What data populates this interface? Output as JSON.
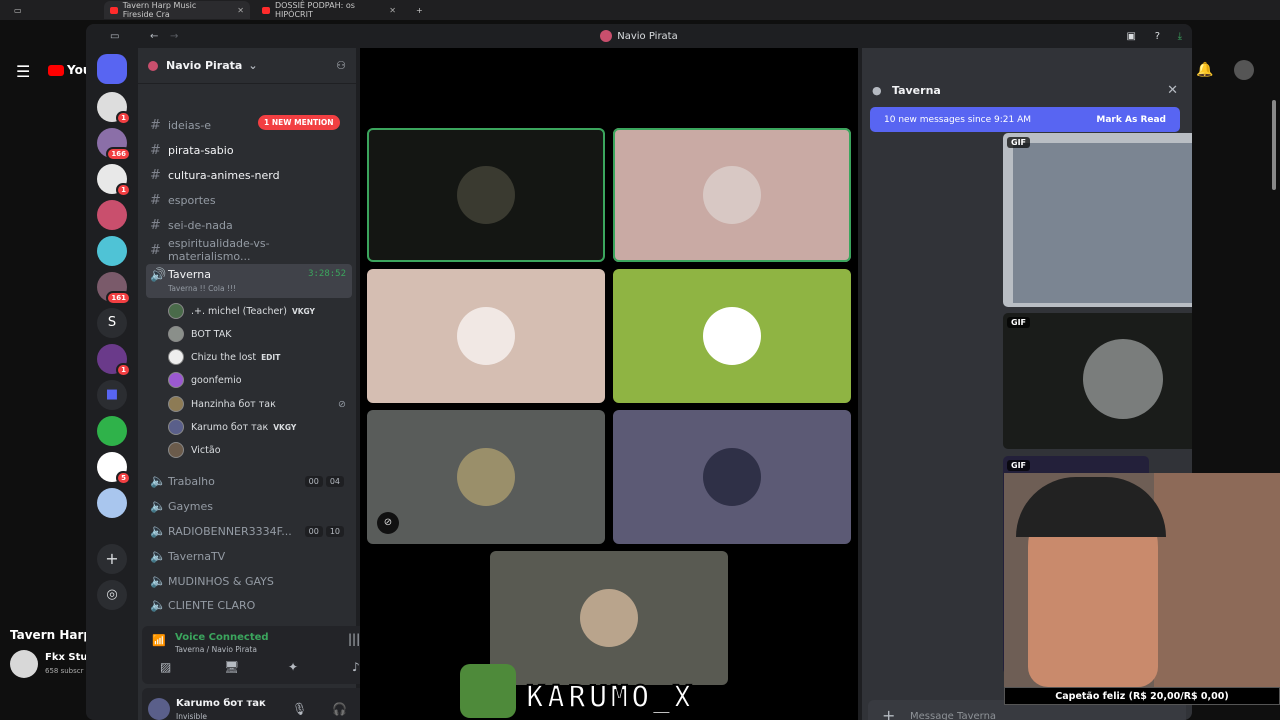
{
  "browser": {
    "tabs": [
      {
        "title": "Tavern Harp Music Fireside Cra"
      },
      {
        "title": "DOSSIÊ PODPAH: os HIPÓCRIT"
      }
    ]
  },
  "youtube": {
    "logo": "You",
    "video_title": "Tavern Harp",
    "channel_name": "Fkx Stud",
    "subscribers": "658 subscr"
  },
  "discord": {
    "window_title": "Navio Pirata",
    "server_name": "Navio Pirata",
    "mention_pill": "1 NEW MENTION",
    "channels": [
      {
        "name": "ideias-e",
        "type": "text"
      },
      {
        "name": "pirata-sabio",
        "type": "text",
        "bright": true
      },
      {
        "name": "cultura-animes-nerd",
        "type": "text",
        "bright": true
      },
      {
        "name": "esportes",
        "type": "text"
      },
      {
        "name": "sei-de-nada",
        "type": "text"
      },
      {
        "name": "espiritualidade-vs-materialismo...",
        "type": "text"
      }
    ],
    "voice_channel": {
      "name": "Taverna",
      "timer": "3:28:52",
      "status": "Taverna !! Cola !!!"
    },
    "voice_members": [
      {
        "name": ".+. michel (Teacher)",
        "tag": "VKGY"
      },
      {
        "name": "BOT TAK",
        "tag": ""
      },
      {
        "name": "Chizu the lost",
        "tag": "EDIT"
      },
      {
        "name": "goonfemio",
        "tag": ""
      },
      {
        "name": "Hanzinha бот так",
        "tag": ""
      },
      {
        "name": "Karumo бот так",
        "tag": "VKGY"
      },
      {
        "name": "Victão",
        "tag": ""
      }
    ],
    "other_voice_channels": [
      {
        "name": "Trabalho",
        "counter": [
          "00",
          "04"
        ]
      },
      {
        "name": "Gaymes",
        "counter": []
      },
      {
        "name": "RADIOBENNER3334F...",
        "counter": [
          "00",
          "10"
        ]
      },
      {
        "name": "TavernaTV",
        "counter": []
      },
      {
        "name": "MUDINHOS & GAYS",
        "counter": []
      },
      {
        "name": "CLIENTE CLARO",
        "counter": []
      }
    ],
    "server_badges": [
      "1",
      "166",
      "1",
      "161",
      "1",
      "5"
    ],
    "server_letter": "S",
    "voice_status": {
      "title": "Voice Connected",
      "location": "Taverna / Navio Pirata"
    },
    "user": {
      "name": "Karumo бот так",
      "status": "Invisible"
    },
    "chat": {
      "channel": "Taverna",
      "new_messages": "10 new messages since 9:21 AM",
      "mark_read": "Mark As Read",
      "gif_label": "GIF",
      "input_placeholder": "Message Taverna"
    }
  },
  "overlay": {
    "banner": "KARUMO_X",
    "cam_label": "Capetão feliz (R$ 20,00/R$ 0,00)"
  }
}
